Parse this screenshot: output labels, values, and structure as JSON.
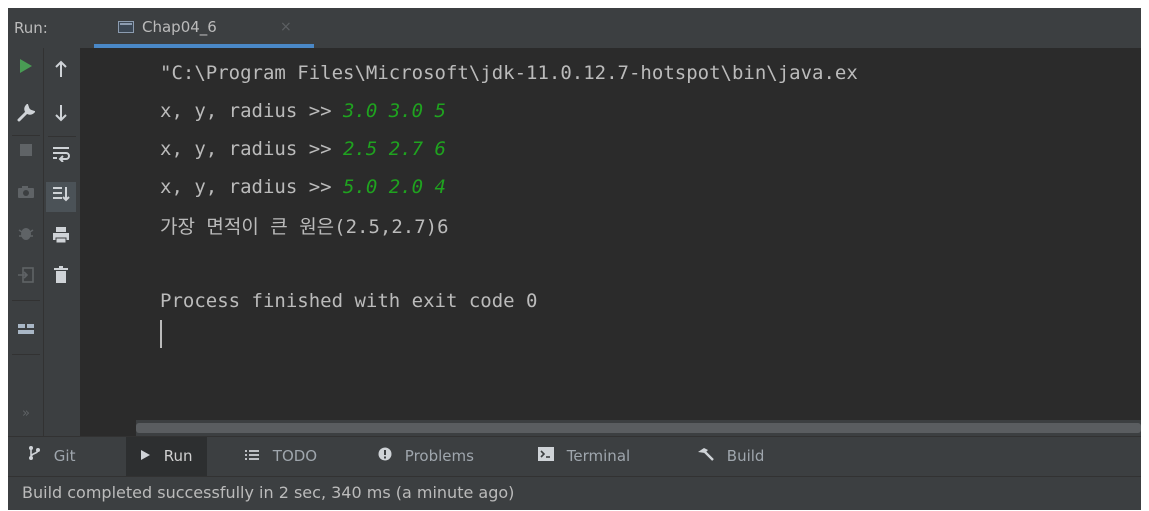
{
  "run_header": {
    "label": "Run:",
    "tab_title": "Chap04_6",
    "tab_close": "×"
  },
  "colors": {
    "background": "#2b2b2b",
    "panel": "#3c3f41",
    "user_input": "#1fa31f",
    "accent": "#4a88c7"
  },
  "left_toolbar": {
    "icons": [
      "run-icon",
      "wrench-icon",
      "stop-icon",
      "camera-icon",
      "bug-icon",
      "exit-icon",
      "layout-icon",
      "more-icon"
    ],
    "more_label": "»"
  },
  "console_toolbar": {
    "icons": [
      "arrow-up-icon",
      "arrow-down-icon",
      "soft-wrap-icon",
      "scroll-to-end-icon",
      "print-icon",
      "trash-icon"
    ]
  },
  "console": {
    "command": "\"C:\\Program Files\\Microsoft\\jdk-11.0.12.7-hotspot\\bin\\java.ex",
    "prompts": [
      {
        "prompt": "x, y, radius >> ",
        "input": "3.0 3.0 5"
      },
      {
        "prompt": "x, y, radius >> ",
        "input": "2.5 2.7 6"
      },
      {
        "prompt": "x, y, radius >> ",
        "input": "5.0 2.0 4"
      }
    ],
    "result": "가장 면적이 큰 원은(2.5,2.7)6",
    "exit_message": "Process finished with exit code 0"
  },
  "tool_windows": [
    {
      "label": "Git",
      "icon": "git-icon",
      "active": false
    },
    {
      "label": "Run",
      "icon": "play-icon",
      "active": true
    },
    {
      "label": "TODO",
      "icon": "list-icon",
      "active": false
    },
    {
      "label": "Problems",
      "icon": "problems-icon",
      "active": false
    },
    {
      "label": "Terminal",
      "icon": "terminal-icon",
      "active": false
    },
    {
      "label": "Build",
      "icon": "hammer-icon",
      "active": false
    }
  ],
  "status_bar": {
    "message": "Build completed successfully in 2 sec, 340 ms (a minute ago)"
  }
}
